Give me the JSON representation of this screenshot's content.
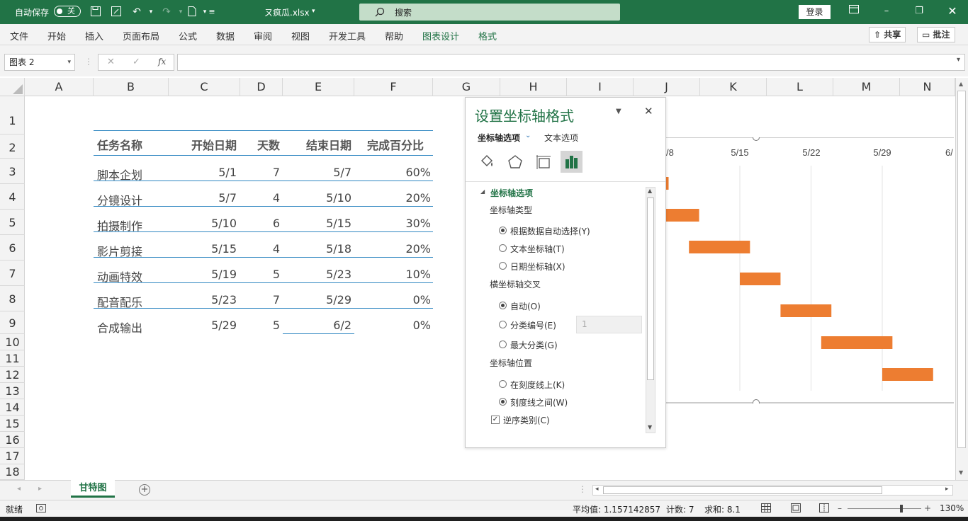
{
  "titlebar": {
    "autosave_label": "自动保存",
    "autosave_state": "关",
    "filename": "ㄡ疯瓜.xlsx",
    "search_label": "搜索",
    "login_label": "登录"
  },
  "ribbon": {
    "tabs": [
      "文件",
      "开始",
      "插入",
      "页面布局",
      "公式",
      "数据",
      "审阅",
      "视图",
      "开发工具",
      "帮助",
      "图表设计",
      "格式"
    ],
    "share_label": "共享",
    "comment_label": "批注"
  },
  "formula_bar": {
    "name_box": "图表 2",
    "fx": "fx",
    "value": ""
  },
  "columns": [
    "A",
    "B",
    "C",
    "D",
    "E",
    "F",
    "G",
    "H",
    "I",
    "J",
    "K",
    "L",
    "M",
    "N"
  ],
  "rows": [
    "1",
    "2",
    "3",
    "4",
    "5",
    "6",
    "7",
    "8",
    "9",
    "10",
    "11",
    "12",
    "13",
    "14",
    "15",
    "16",
    "17",
    "18"
  ],
  "table": {
    "headers": [
      "任务名称",
      "开始日期",
      "天数",
      "结束日期",
      "完成百分比"
    ],
    "rows": [
      [
        "脚本企划",
        "5/1",
        "7",
        "5/7",
        "60%"
      ],
      [
        "分镜设计",
        "5/7",
        "4",
        "5/10",
        "20%"
      ],
      [
        "拍摄制作",
        "5/10",
        "6",
        "5/15",
        "30%"
      ],
      [
        "影片剪接",
        "5/15",
        "4",
        "5/18",
        "20%"
      ],
      [
        "动画特效",
        "5/19",
        "5",
        "5/23",
        "10%"
      ],
      [
        "配音配乐",
        "5/23",
        "7",
        "5/29",
        "0%"
      ],
      [
        "合成输出",
        "5/29",
        "5",
        "6/2",
        "0%"
      ]
    ]
  },
  "chart_data": {
    "type": "bar",
    "orientation": "horizontal-gantt",
    "x_tick_labels": [
      "/8",
      "5/15",
      "5/22",
      "5/29",
      "6/"
    ],
    "categories": [
      "脚本企划",
      "分镜设计",
      "拍摄制作",
      "影片剪接",
      "动画特效",
      "配音配乐",
      "合成输出"
    ],
    "series": [
      {
        "start": [
          "5/1",
          "5/7",
          "5/10",
          "5/15",
          "5/19",
          "5/23",
          "5/29"
        ],
        "days": [
          7,
          4,
          6,
          4,
          5,
          7,
          5
        ],
        "color": "#ed7d31"
      }
    ],
    "reverse_categories": true,
    "gridlines": "vertical"
  },
  "format_panel": {
    "title": "设置坐标轴格式",
    "tab_axis": "坐标轴选项",
    "tab_text": "文本选项",
    "section": "坐标轴选项",
    "axis_type_label": "坐标轴类型",
    "axis_type_options": [
      "根据数据自动选择(Y)",
      "文本坐标轴(T)",
      "日期坐标轴(X)"
    ],
    "axis_type_selected": 0,
    "cross_label": "横坐标轴交叉",
    "cross_options": [
      "自动(O)",
      "分类编号(E)",
      "最大分类(G)"
    ],
    "cross_selected": 0,
    "cross_value": "1",
    "position_label": "坐标轴位置",
    "position_options": [
      "在刻度线上(K)",
      "刻度线之间(W)"
    ],
    "position_selected": 1,
    "reverse_label": "逆序类别(C)",
    "reverse_checked": true
  },
  "sheet": {
    "tab_name": "甘特图"
  },
  "statusbar": {
    "mode": "就绪",
    "average": "平均值: 1.157142857",
    "count": "计数: 7",
    "sum": "求和: 8.1",
    "zoom": "130%"
  },
  "colors": {
    "accent": "#217346",
    "bar": "#ed7d31",
    "table_line": "#2e86c1"
  }
}
